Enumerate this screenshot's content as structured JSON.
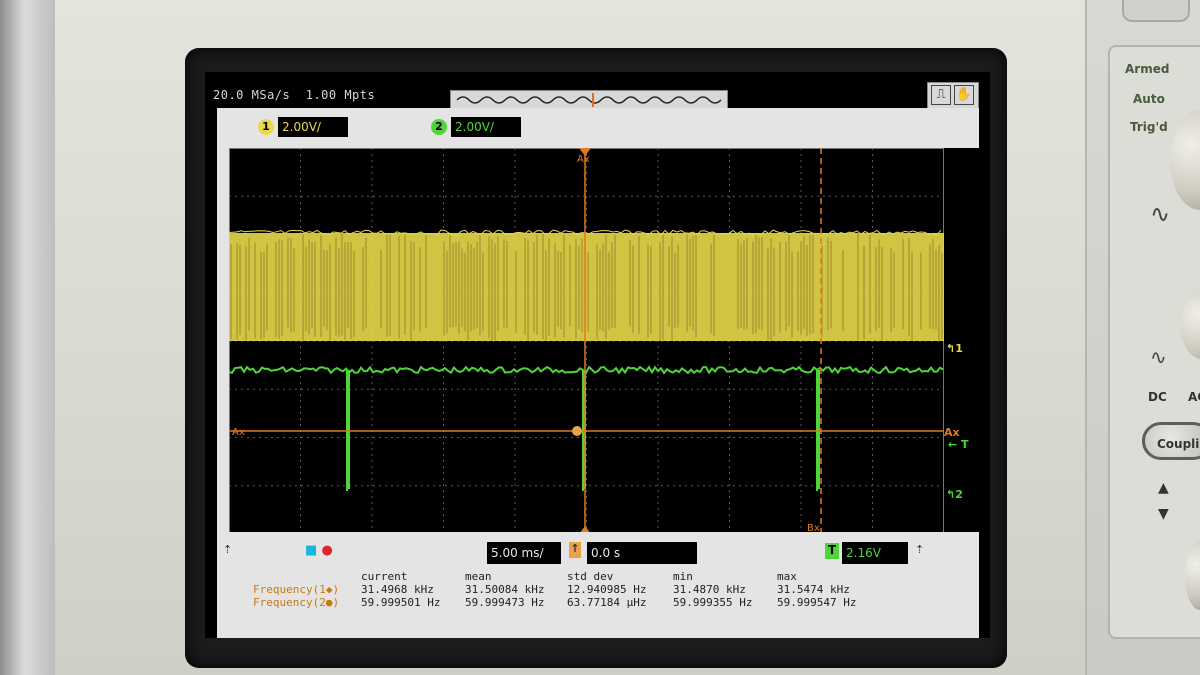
{
  "header": {
    "sample_rate": "20.0 MSa/s",
    "memory_depth": "1.00 Mpts",
    "mode_buttons": [
      "⎍",
      "✋"
    ]
  },
  "channels": [
    {
      "number": "1",
      "scale": "2.00V/",
      "color": "#e9d94a"
    },
    {
      "number": "2",
      "scale": "2.00V/",
      "color": "#4fd43a"
    }
  ],
  "markers": {
    "ax": "Ax",
    "bx": "Bx",
    "trigger": "← T",
    "ch1_ref": "↰1",
    "ch2_ref": "↰2"
  },
  "timebase": {
    "time_per_div": "5.00 ms/",
    "delay": "0.0 s",
    "trigger_level": "2.16V",
    "trigger_label": "T"
  },
  "measurements": {
    "headers": [
      "current",
      "mean",
      "std dev",
      "min",
      "max"
    ],
    "rows": [
      {
        "label": "Frequency(1◆)",
        "values": [
          "31.4968 kHz",
          "31.50084 kHz",
          "12.940985 Hz",
          "31.4870 kHz",
          "31.5474 kHz"
        ],
        "color": "#c77a12"
      },
      {
        "label": "Frequency(2●)",
        "values": [
          "59.999501 Hz",
          "59.999473 Hz",
          "63.77184 µHz",
          "59.999355 Hz",
          "59.999547 Hz"
        ],
        "color": "#c77a12"
      }
    ]
  },
  "panel": {
    "status": [
      "Armed",
      "Auto",
      "Trig'd"
    ],
    "dc_label": "DC",
    "ac_label": "AC",
    "coupling_label": "Coupling"
  }
}
